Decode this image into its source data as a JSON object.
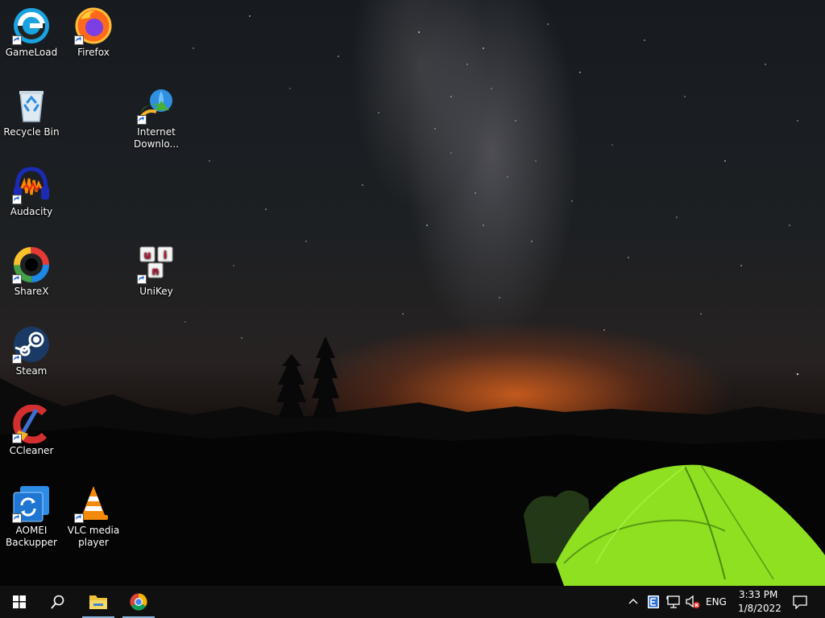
{
  "desktop": {
    "icons": [
      {
        "id": "gameload",
        "label": "GameLoad",
        "icon": "gameload-icon"
      },
      {
        "id": "firefox",
        "label": "Firefox",
        "icon": "firefox-icon"
      },
      {
        "id": "recycle",
        "label": "Recycle Bin",
        "icon": "recycle-bin-icon"
      },
      {
        "id": "idm",
        "label": "Internet Downlo...",
        "icon": "internet-download-manager-icon"
      },
      {
        "id": "audacity",
        "label": "Audacity",
        "icon": "audacity-icon"
      },
      {
        "id": "sharex",
        "label": "ShareX",
        "icon": "sharex-icon"
      },
      {
        "id": "unikey",
        "label": "UniKey",
        "icon": "unikey-icon"
      },
      {
        "id": "steam",
        "label": "Steam",
        "icon": "steam-icon"
      },
      {
        "id": "ccleaner",
        "label": "CCleaner",
        "icon": "ccleaner-icon"
      },
      {
        "id": "aomei",
        "label": "AOMEI Backupper",
        "icon": "aomei-backupper-icon"
      },
      {
        "id": "vlc",
        "label": "VLC media player",
        "icon": "vlc-icon"
      }
    ],
    "unikey_letters": [
      "u",
      "i",
      "n"
    ]
  },
  "taskbar": {
    "pinned": [
      {
        "name": "start-button",
        "icon": "windows-logo-icon"
      },
      {
        "name": "search-button",
        "icon": "search-icon"
      },
      {
        "name": "file-explorer",
        "icon": "folder-icon",
        "active": true
      },
      {
        "name": "chrome",
        "icon": "chrome-icon",
        "active": true
      }
    ],
    "tray": {
      "language": "ENG",
      "time": "3:33 PM",
      "date": "1/8/2022"
    },
    "tray_icons": [
      "chevron-up-icon",
      "app-tray-icon",
      "network-icon",
      "volume-muted-icon",
      "notification-icon"
    ]
  },
  "colors": {
    "taskbar_bg": "#101010",
    "active_indicator": "#8fb7e0",
    "tent_green": "#8fe021",
    "horizon_glow": "#e8691e"
  }
}
